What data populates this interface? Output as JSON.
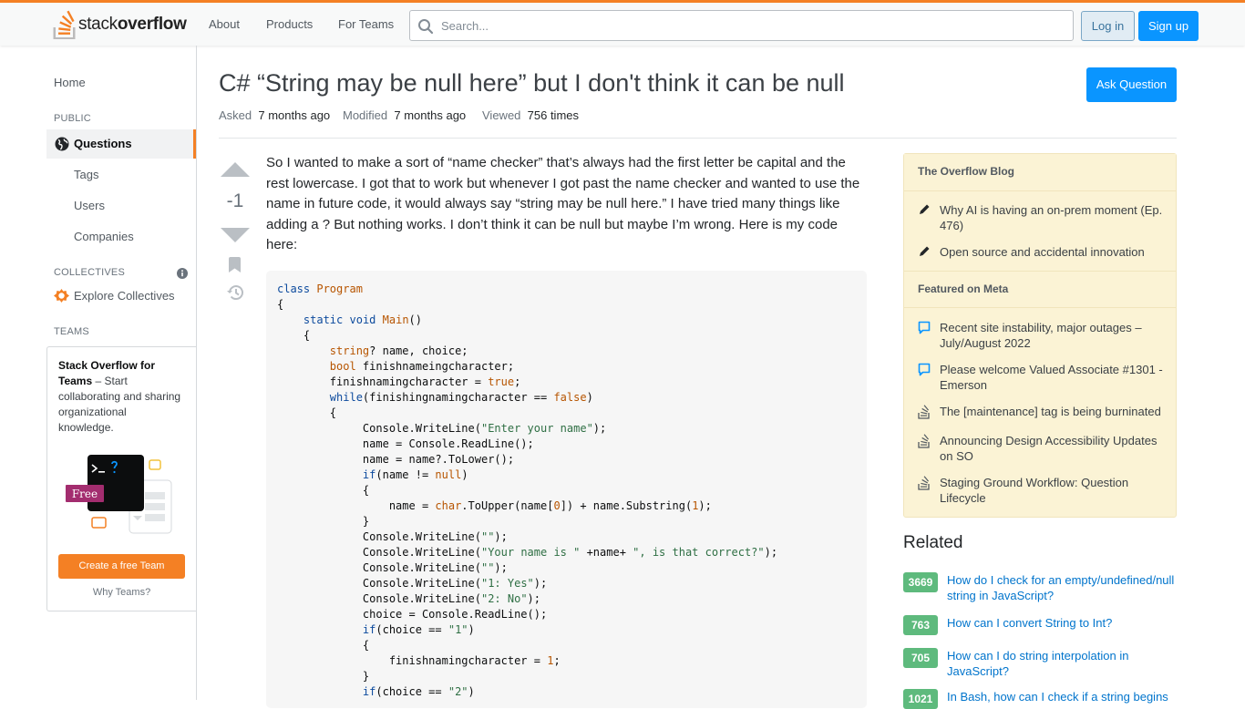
{
  "header": {
    "logo_word_light": "stack",
    "logo_word_bold": "overflow",
    "nav": [
      "About",
      "Products",
      "For Teams"
    ],
    "search_placeholder": "Search...",
    "login": "Log in",
    "signup": "Sign up",
    "accent": "#f48024"
  },
  "sidebar": {
    "home": "Home",
    "public_heading": "PUBLIC",
    "questions": "Questions",
    "tags": "Tags",
    "users": "Users",
    "companies": "Companies",
    "collectives_heading": "COLLECTIVES",
    "explore_collectives": "Explore Collectives",
    "teams_heading": "TEAMS",
    "teams_title": "Stack Overflow for Teams",
    "teams_dash": " – ",
    "teams_desc": "Start collaborating and sharing organizational knowledge.",
    "free_badge": "Free",
    "create_team": "Create a free Team",
    "why_teams": "Why Teams?"
  },
  "question": {
    "title": "C# “String may be null here” but I don't think it can be null",
    "ask_button": "Ask Question",
    "asked_label": "Asked",
    "asked_value": "7 months ago",
    "modified_label": "Modified",
    "modified_value": "7 months ago",
    "viewed_label": "Viewed",
    "viewed_value": "756 times",
    "votes": "-1",
    "body": "So I wanted to make a sort of “name checker” that’s always had the first letter be capital and the rest lowercase. I got that to work but whenever I got past the name checker and wanted to use the name in future code, it would always say “string may be null here.” I have tried many things like adding a ? But nothing works. I don’t think it can be null but maybe I’m wrong. Here is my code here:"
  },
  "blog": {
    "heading": "The Overflow Blog",
    "items": [
      "Why AI is having an on-prem moment (Ep. 476)",
      "Open source and accidental innovation"
    ],
    "meta_heading": "Featured on Meta",
    "meta_items": [
      "Recent site instability, major outages – July/August 2022",
      "Please welcome Valued Associate #1301 - Emerson",
      "The [maintenance] tag is being burninated",
      "Announcing Design Accessibility Updates on SO",
      "Staging Ground Workflow: Question Lifecycle"
    ]
  },
  "related": {
    "heading": "Related",
    "items": [
      {
        "score": "3669",
        "title": "How do I check for an empty/undefined/null string in JavaScript?"
      },
      {
        "score": "763",
        "title": "How can I convert String to Int?"
      },
      {
        "score": "705",
        "title": "How can I do string interpolation in JavaScript?"
      },
      {
        "score": "1021",
        "title": "In Bash, how can I check if a string begins"
      }
    ]
  }
}
